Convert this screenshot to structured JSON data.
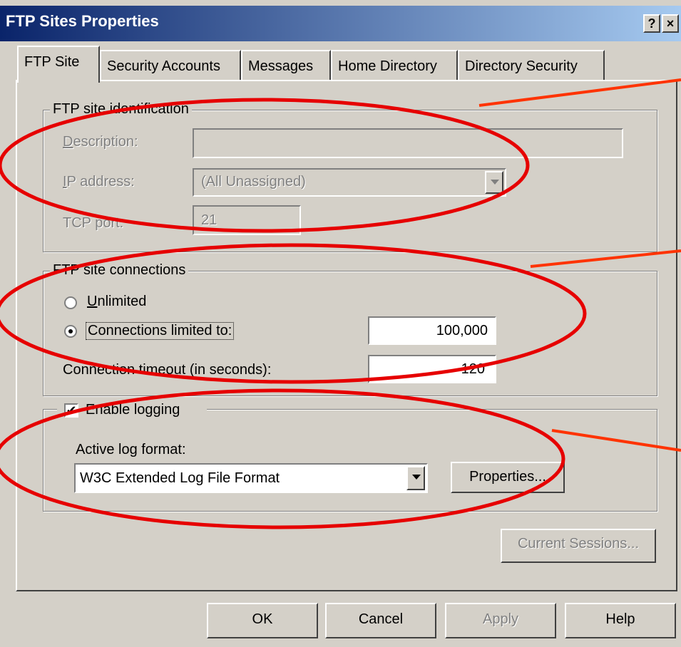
{
  "window": {
    "title": "FTP Sites Properties",
    "help_label": "?",
    "close_label": "×"
  },
  "tabs": [
    "FTP Site",
    "Security Accounts",
    "Messages",
    "Home Directory",
    "Directory Security"
  ],
  "identification": {
    "legend": "FTP site identification",
    "description_label": "Description:",
    "description_value": "",
    "ip_label": "IP address:",
    "ip_value": "(All Unassigned)",
    "port_label": "TCP port:",
    "port_value": "21"
  },
  "connections": {
    "legend": "FTP site connections",
    "unlimited_label": "Unlimited",
    "limited_label": "Connections limited to:",
    "limited_value": "100,000",
    "timeout_label": "Connection timeout (in seconds):",
    "timeout_value": "120",
    "selected": "limited"
  },
  "logging": {
    "enable_label": "Enable logging",
    "enabled": true,
    "format_label": "Active log format:",
    "format_value": "W3C Extended Log File Format",
    "properties_label": "Properties..."
  },
  "current_sessions_label": "Current Sessions...",
  "buttons": {
    "ok": "OK",
    "cancel": "Cancel",
    "apply": "Apply",
    "help": "Help"
  },
  "annotation_color": "#e60000",
  "pointer_color": "#ff3300"
}
